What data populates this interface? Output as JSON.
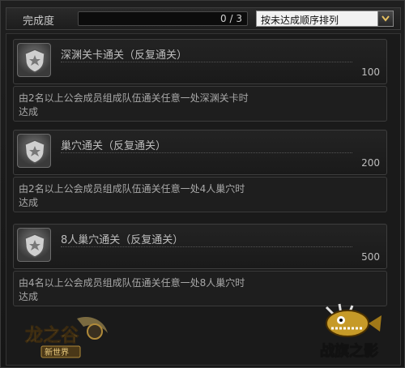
{
  "header": {
    "label": "完成度",
    "progress_text": "0 / 3",
    "progress_fraction": 0,
    "sort_value": "按未达成顺序排列"
  },
  "items": [
    {
      "title": "深渊关卡通关（反复通关）",
      "points": "100",
      "desc_1": "由2名以上公会成员组成队伍通关任意一处深渊关卡时",
      "desc_2": "达成"
    },
    {
      "title": "巢穴通关（反复通关）",
      "points": "200",
      "desc_1": "由2名以上公会成员组成队伍通关任意一处4人巢穴时",
      "desc_2": "达成"
    },
    {
      "title": "8人巢穴通关（反复通关）",
      "points": "500",
      "desc_1": "由4名以上公会成员组成队伍通关任意一处8人巢穴时",
      "desc_2": "达成"
    }
  ],
  "logos": {
    "left_logo_text": "龙之谷",
    "left_logo_sub": "新世界",
    "right_logo_text": "战旗之影"
  },
  "colors": {
    "accent": "#c8a040",
    "badge": "#6c6c6c"
  }
}
